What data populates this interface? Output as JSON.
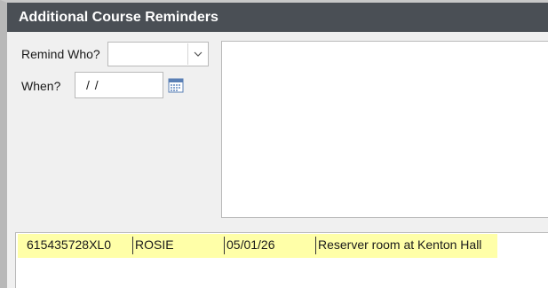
{
  "window": {
    "title": "Additional Course Reminders"
  },
  "form": {
    "remind_who_label": "Remind Who?",
    "remind_who_value": "",
    "when_label": "When?",
    "when_value": "/ /"
  },
  "notes": {
    "value": ""
  },
  "reminders": {
    "rows": [
      {
        "id": "615435728XL0",
        "who": "ROSIE",
        "date": "05/01/26",
        "note": "Reserver room at Kenton Hall"
      }
    ]
  },
  "icons": {
    "dropdown": "chevron-down-icon",
    "date_picker": "calendar-icon"
  },
  "colors": {
    "titlebar": "#4a4f55",
    "row_highlight": "#ffffa8"
  }
}
